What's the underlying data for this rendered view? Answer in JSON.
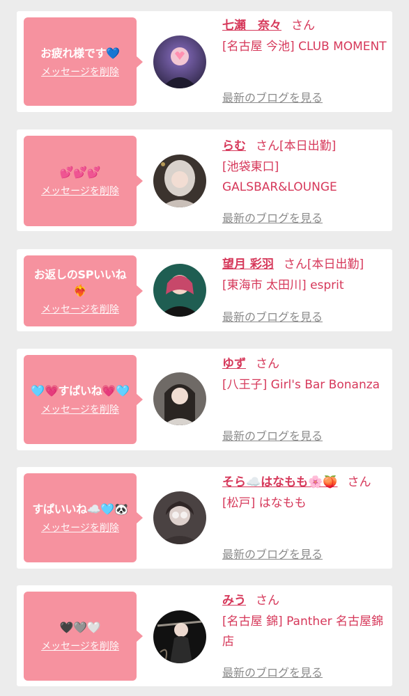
{
  "items": [
    {
      "message": "お疲れ様です💙",
      "delete_label": "メッセージを削除",
      "name": "七瀬　奈々",
      "san": "さん",
      "status": "",
      "shop": "[名古屋 今池] CLUB MOMENT",
      "blog_label": "最新のブログを見る"
    },
    {
      "message": "💕💕💕",
      "delete_label": "メッセージを削除",
      "name": "らむ",
      "san": "さん",
      "status": "[本日出勤]",
      "shop": "[池袋東口] GALSBAR&LOUNGE",
      "blog_label": "最新のブログを見る"
    },
    {
      "message": "お返しのSPいいね❤️‍🔥",
      "delete_label": "メッセージを削除",
      "name": "望月 彩羽",
      "san": "さん",
      "status": "[本日出勤]",
      "shop": "[東海市 太田川] esprit",
      "blog_label": "最新のブログを見る"
    },
    {
      "message": "🩵💗すぱいね💗🩵",
      "delete_label": "メッセージを削除",
      "name": "ゆず",
      "san": "さん",
      "status": "",
      "shop": "[八王子] Girl's Bar Bonanza",
      "blog_label": "最新のブログを見る"
    },
    {
      "message": "すぱいいね☁️🩵🐼",
      "delete_label": "メッセージを削除",
      "name": "そら☁️はなもも🌸🍑",
      "san": "さん",
      "status": "",
      "shop": "[松戸] はなもも",
      "blog_label": "最新のブログを見る"
    },
    {
      "message": "🖤🩶🤍",
      "delete_label": "メッセージを削除",
      "name": "みう",
      "san": "さん",
      "status": "",
      "shop": "[名古屋 錦] Panther 名古屋錦店",
      "blog_label": "最新のブログを見る"
    }
  ],
  "colors": {
    "page_bg": "#ececec",
    "bubble_bg": "#f6929f",
    "accent_text": "#d6385a",
    "link_gray": "#8b8b8b"
  }
}
